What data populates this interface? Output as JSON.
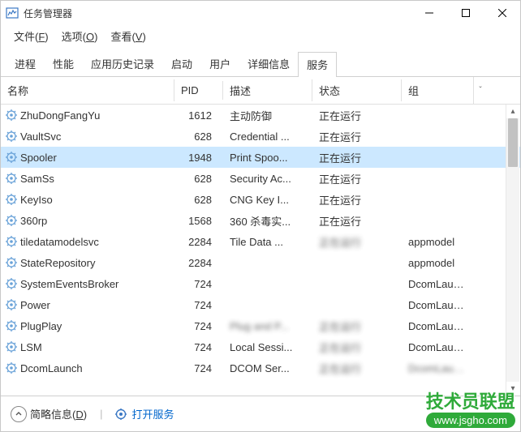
{
  "window": {
    "title": "任务管理器"
  },
  "menu": {
    "file": "文件(F)",
    "options": "选项(O)",
    "view": "查看(V)"
  },
  "tabs": {
    "processes": "进程",
    "performance": "性能",
    "appHistory": "应用历史记录",
    "startup": "启动",
    "users": "用户",
    "details": "详细信息",
    "services": "服务"
  },
  "columns": {
    "name": "名称",
    "pid": "PID",
    "description": "描述",
    "status": "状态",
    "group": "组"
  },
  "rows": [
    {
      "name": "ZhuDongFangYu",
      "pid": "1612",
      "desc": "主动防御",
      "stat": "正在运行",
      "grp": ""
    },
    {
      "name": "VaultSvc",
      "pid": "628",
      "desc": "Credential ...",
      "stat": "正在运行",
      "grp": ""
    },
    {
      "name": "Spooler",
      "pid": "1948",
      "desc": "Print Spoo...",
      "stat": "正在运行",
      "grp": "",
      "selected": true
    },
    {
      "name": "SamSs",
      "pid": "628",
      "desc": "Security Ac...",
      "stat": "正在运行",
      "grp": ""
    },
    {
      "name": "KeyIso",
      "pid": "628",
      "desc": "CNG Key I...",
      "stat": "正在运行",
      "grp": ""
    },
    {
      "name": "360rp",
      "pid": "1568",
      "desc": "360 杀毒实...",
      "stat": "正在运行",
      "grp": ""
    },
    {
      "name": "tiledatamodelsvc",
      "pid": "2284",
      "desc": "Tile Data ...",
      "stat": "正在运行",
      "grp": "appmodel",
      "blurStat": true
    },
    {
      "name": "StateRepository",
      "pid": "2284",
      "desc": "",
      "stat": "",
      "grp": "appmodel",
      "blurMid": true
    },
    {
      "name": "SystemEventsBroker",
      "pid": "724",
      "desc": "",
      "stat": "",
      "grp": "DcomLaun...",
      "blurMid": true
    },
    {
      "name": "Power",
      "pid": "724",
      "desc": "",
      "stat": "",
      "grp": "DcomLaun...",
      "blurMid": true
    },
    {
      "name": "PlugPlay",
      "pid": "724",
      "desc": "Plug and P...",
      "stat": "正在运行",
      "grp": "DcomLaun...",
      "blurStat": true,
      "blurDesc": true
    },
    {
      "name": "LSM",
      "pid": "724",
      "desc": "Local Sessi...",
      "stat": "正在运行",
      "grp": "DcomLaun...",
      "blurStat": true
    },
    {
      "name": "DcomLaunch",
      "pid": "724",
      "desc": "DCOM Ser...",
      "stat": "正在运行",
      "grp": "DcomLaun...",
      "blurStat": true,
      "blurGrp": true
    }
  ],
  "statusbar": {
    "briefInfo": "简略信息(D)",
    "openServices": "打开服务"
  },
  "watermark": {
    "text": "技术员联盟",
    "url": "www.jsgho.com"
  }
}
